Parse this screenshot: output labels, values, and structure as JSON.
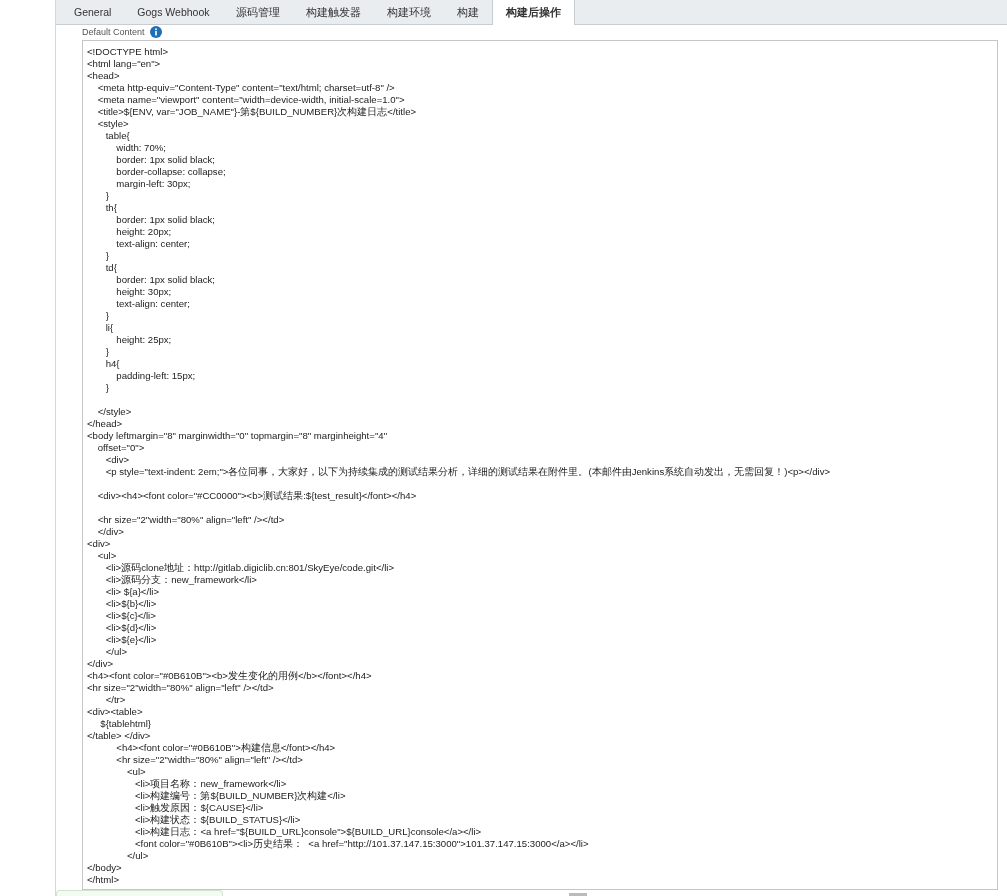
{
  "tabs": [
    {
      "label": "General",
      "selected": false
    },
    {
      "label": "Gogs Webhook",
      "selected": false
    },
    {
      "label": "源码管理",
      "selected": false
    },
    {
      "label": "构建触发器",
      "selected": false
    },
    {
      "label": "构建环境",
      "selected": false
    },
    {
      "label": "构建",
      "selected": false
    },
    {
      "label": "构建后操作",
      "selected": true
    }
  ],
  "default_content": {
    "label": "Default Content",
    "value": "<!DOCTYPE html>\n<html lang=\"en\">\n<head>\n    <meta http-equiv=\"Content-Type\" content=\"text/html; charset=utf-8\" />\n    <meta name=\"viewport\" content=\"width=device-width, initial-scale=1.0\">\n    <title>${ENV, var=\"JOB_NAME\"}-第${BUILD_NUMBER}次构建日志</title>\n    <style>\n       table{\n           width: 70%;\n           border: 1px solid black;\n           border-collapse: collapse;\n           margin-left: 30px;\n       }\n       th{\n           border: 1px solid black;\n           height: 20px;\n           text-align: center;\n       }\n       td{\n           border: 1px solid black;\n           height: 30px;\n           text-align: center;\n       }\n       li{\n           height: 25px;\n       }\n       h4{\n           padding-left: 15px;\n       }\n\n    </style>\n</head>\n<body leftmargin=\"8\" marginwidth=\"0\" topmargin=\"8\" marginheight=\"4\"\n    offset=\"0\">\n       <div>\n       <p style=\"text-indent: 2em;\">各位同事，大家好，以下为持续集成的测试结果分析，详细的测试结果在附件里。(本邮件由Jenkins系统自动发出，无需回复！)<p></div>\n\n    <div><h4><font color=\"#CC0000\"><b>测试结果:${test_result}</font></h4>\n\n    <hr size=\"2\"width=\"80%\" align=\"left\" /></td>\n    </div>\n<div>\n    <ul>\n       <li>源码clone地址：http://gitlab.digiclib.cn:801/SkyEye/code.git</li>\n       <li>源码分支：new_framework</li>\n       <li> ${a}</li>\n       <li>${b}</li>\n       <li>${c}</li>\n       <li>${d}</li>\n       <li>${e}</li>\n       </ul>\n</div>\n<h4><font color=\"#0B610B\"><b>发生变化的用例</b></font></h4>\n<hr size=\"2\"width=\"80%\" align=\"left\" /></td>\n       </tr>\n<div><table>\n     ${tablehtml}\n</table> </div>\n           <h4><font color=\"#0B610B\">构建信息</font></h4>\n           <hr size=\"2\"width=\"80%\" align=\"left\" /></td>\n               <ul>\n                  <li>项目名称：new_framework</li>\n                  <li>构建编号：第${BUILD_NUMBER}次构建</li>\n                  <li>触发原因：${CAUSE}</li>\n                  <li>构建状态：${BUILD_STATUS}</li>\n                  <li>构建日志：<a href=\"${BUILD_URL}console\">${BUILD_URL}console</a></li>\n                  <font color=\"#0B610B\"><li>历史结果：  <a href=\"http://101.37.147.15:3000\">101.37.147.15:3000</a></li>\n               </ul>\n</body>\n</html>"
  }
}
